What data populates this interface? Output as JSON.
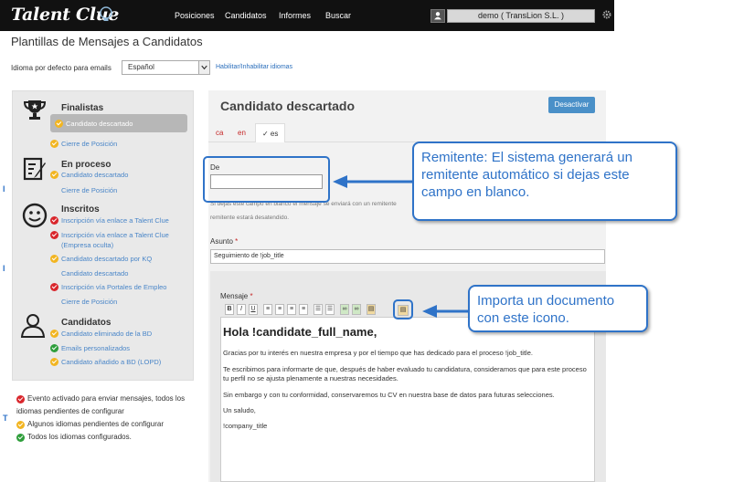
{
  "navbar": {
    "logo": "Talent Clue",
    "links": [
      "Posiciones",
      "Candidatos",
      "Informes",
      "Buscar"
    ],
    "user": "demo ( TransLion S.L. )"
  },
  "page": {
    "title": "Plantillas de Mensajes a Candidatos",
    "lang_label": "Idioma por defecto para emails",
    "lang_value": "Español",
    "lang_link": "Habilitar/Inhabilitar idiomas"
  },
  "sidebar": {
    "finalistas": {
      "title": "Finalistas",
      "items": [
        {
          "label": "Candidato descartado",
          "status": "yellow"
        },
        {
          "label": "Cierre de Posición",
          "status": "yellow"
        }
      ]
    },
    "en_proceso": {
      "title": "En proceso",
      "items": [
        {
          "label": "Candidato descartado",
          "status": "yellow"
        },
        {
          "label": "Cierre de Posición",
          "status": "none"
        }
      ]
    },
    "inscritos": {
      "title": "Inscritos",
      "items": [
        {
          "label": "Inscripción vía enlace a Talent Clue",
          "status": "red"
        },
        {
          "label": "Inscripción vía enlace a Talent Clue",
          "status": "red"
        },
        {
          "label": "(Empresa oculta)",
          "status": "none"
        },
        {
          "label": "Candidato descartado por KQ",
          "status": "yellow"
        },
        {
          "label": "Candidato descartado",
          "status": "none"
        },
        {
          "label": "Inscripción vía Portales de Empleo",
          "status": "red"
        },
        {
          "label": "Cierre de Posición",
          "status": "none"
        }
      ]
    },
    "candidatos": {
      "title": "Candidatos",
      "items": [
        {
          "label": "Candidato eliminado de la BD",
          "status": "yellow"
        },
        {
          "label": "Emails personalizados",
          "status": "green"
        },
        {
          "label": "Candidato añadido a BD (LOPD)",
          "status": "yellow"
        }
      ]
    }
  },
  "legend": {
    "red_1": "Evento activado para enviar mensajes, todos los",
    "red_2": "idiomas pendientes de configurar",
    "yellow": "Algunos idiomas pendientes de configurar",
    "green": "Todos los idiomas configurados."
  },
  "panel": {
    "title": "Candidato descartado",
    "deactivate": "Desactivar",
    "tabs": [
      "ca",
      "en",
      "✓ es"
    ],
    "de_label": "De",
    "help_1": "Si dejas este campo en blanco el mensaje se enviará con un remitente",
    "help_2": "remitente estará desatendido.",
    "asunto_label": "Asunto",
    "asunto_value": "Seguimiento de !job_title",
    "mensaje_label": "Mensaje",
    "req": "*",
    "editor": {
      "heading": "Hola !candidate_full_name,",
      "p1": "Gracias por tu interés en nuestra empresa y por el tiempo que has dedicado para el proceso !job_title.",
      "p2": "Te escribimos para informarte de que, después de haber evaluado tu candidatura, consideramos que para este proceso tu perfil no se ajusta plenamente a nuestras necesidades.",
      "p3": "Sin embargo y con tu conformidad, conservaremos tu CV en nuestra base de datos para futuras selecciones.",
      "p4": "Un saludo,",
      "p5": "!company_title"
    }
  },
  "callouts": {
    "remitente": "Remitente: El sistema generará un remitente automático si dejas este campo en blanco.",
    "importa": "Importa un documento con este icono."
  },
  "colors": {
    "accent": "#2f73c8",
    "red": "#d9262c",
    "yellow": "#f2b521",
    "green": "#2e9e3b",
    "navbar": "#111111"
  }
}
